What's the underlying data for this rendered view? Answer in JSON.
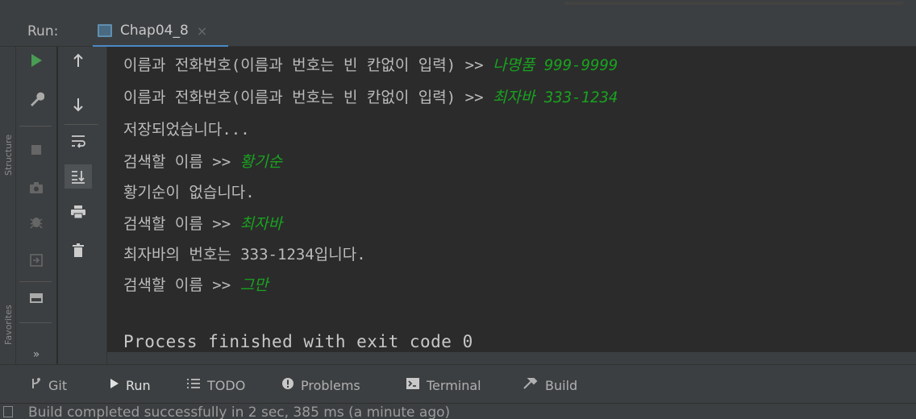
{
  "run_panel": {
    "label": "Run:",
    "tab": {
      "name": "Chap04_8",
      "close": "×"
    }
  },
  "left_strip": {
    "labels": [
      "Structure",
      "Favorites"
    ]
  },
  "console": {
    "lines": [
      {
        "prompt": "이름과 전화번호(이름과 번호는 빈 칸없이 입력) >> ",
        "input": "나명품 999-9999"
      },
      {
        "prompt": "이름과 전화번호(이름과 번호는 빈 칸없이 입력) >> ",
        "input": "최자바 333-1234"
      },
      {
        "prompt": "저장되었습니다...",
        "input": ""
      },
      {
        "prompt": "검색할 이름 >> ",
        "input": "황기순"
      },
      {
        "prompt": "황기순이 없습니다.",
        "input": ""
      },
      {
        "prompt": "검색할 이름 >> ",
        "input": "최자바"
      },
      {
        "prompt": "최자바의 번호는 333-1234입니다.",
        "input": ""
      },
      {
        "prompt": "검색할 이름 >> ",
        "input": "그만"
      }
    ],
    "process_line": "Process finished with exit code 0"
  },
  "bottom_tabs": [
    {
      "label": "Git",
      "icon": "git-icon"
    },
    {
      "label": "Run",
      "icon": "run-icon"
    },
    {
      "label": "TODO",
      "icon": "todo-icon"
    },
    {
      "label": "Problems",
      "icon": "problems-icon"
    },
    {
      "label": "Terminal",
      "icon": "terminal-icon"
    },
    {
      "label": "Build",
      "icon": "build-icon"
    }
  ],
  "status": {
    "text": "Build completed successfully in 2 sec, 385 ms (a minute ago)"
  },
  "colors": {
    "accent": "#4a88c7",
    "input_text": "#19a31f",
    "run_green": "#499c54"
  },
  "toolbar_icons": {
    "col1": [
      "play-icon",
      "wrench-icon",
      "stop-icon",
      "camera-icon",
      "debug-icon",
      "exit-icon",
      "layout-icon",
      "more-icon"
    ],
    "col2": [
      "arrow-up-icon",
      "arrow-down-icon",
      "soft-wrap-icon",
      "scroll-to-end-icon",
      "print-icon",
      "trash-icon"
    ],
    "more_label": "»"
  }
}
